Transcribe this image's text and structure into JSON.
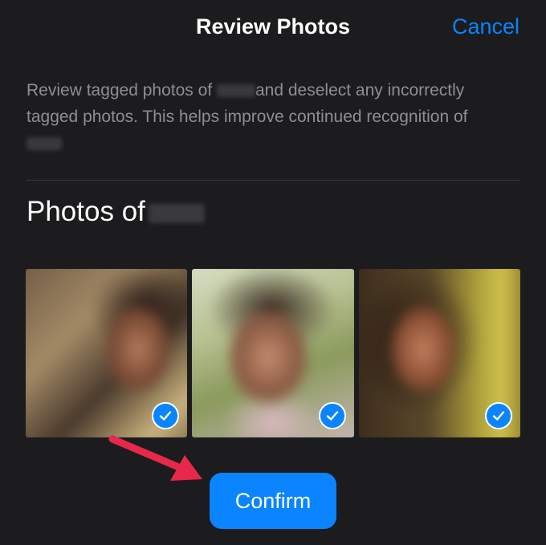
{
  "header": {
    "title": "Review Photos",
    "cancel_label": "Cancel"
  },
  "description": {
    "part1": "Review tagged photos of ",
    "part2": "and deselect any incorrectly tagged photos. This helps improve continued recognition of"
  },
  "section": {
    "title": "Photos of"
  },
  "photos": [
    {
      "selected": true
    },
    {
      "selected": true
    },
    {
      "selected": true
    }
  ],
  "confirm_label": "Confirm",
  "colors": {
    "background": "#1c1c1e",
    "accent": "#0a84ff",
    "secondary_text": "#8e8e93",
    "annotation_arrow": "#e8284a"
  }
}
